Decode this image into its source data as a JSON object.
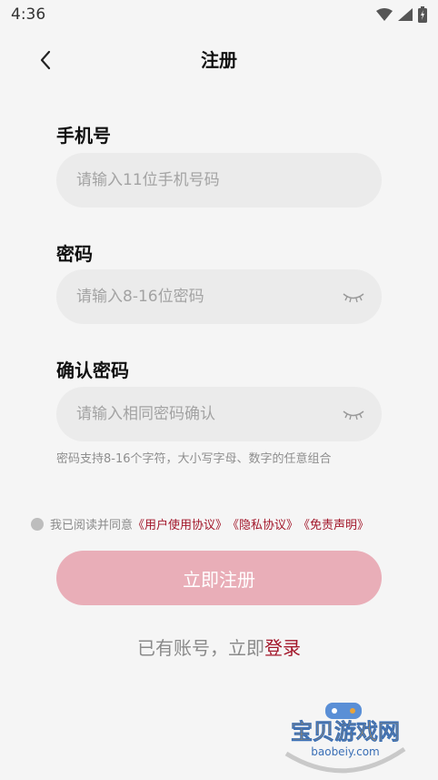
{
  "status": {
    "time": "4:36"
  },
  "nav": {
    "title": "注册"
  },
  "phone": {
    "label": "手机号",
    "placeholder": "请输入11位手机号码"
  },
  "password": {
    "label": "密码",
    "placeholder": "请输入8-16位密码"
  },
  "confirm": {
    "label": "确认密码",
    "placeholder": "请输入相同密码确认"
  },
  "hint": "密码支持8-16个字符，大小写字母、数字的任意组合",
  "agreement": {
    "prefix": "我已阅读并同意",
    "user_agreement": "《用户使用协议》",
    "privacy": "《隐私协议》",
    "disclaimer": "《免责声明》"
  },
  "submit_label": "立即注册",
  "login_prompt": {
    "text": "已有账号，立即",
    "link": "登录"
  },
  "watermark": {
    "title": "宝贝游戏网",
    "url": "baobeiy.com"
  },
  "colors": {
    "accent": "#a3182b",
    "button": "#e9aeb8",
    "field_bg": "#ebebeb"
  }
}
